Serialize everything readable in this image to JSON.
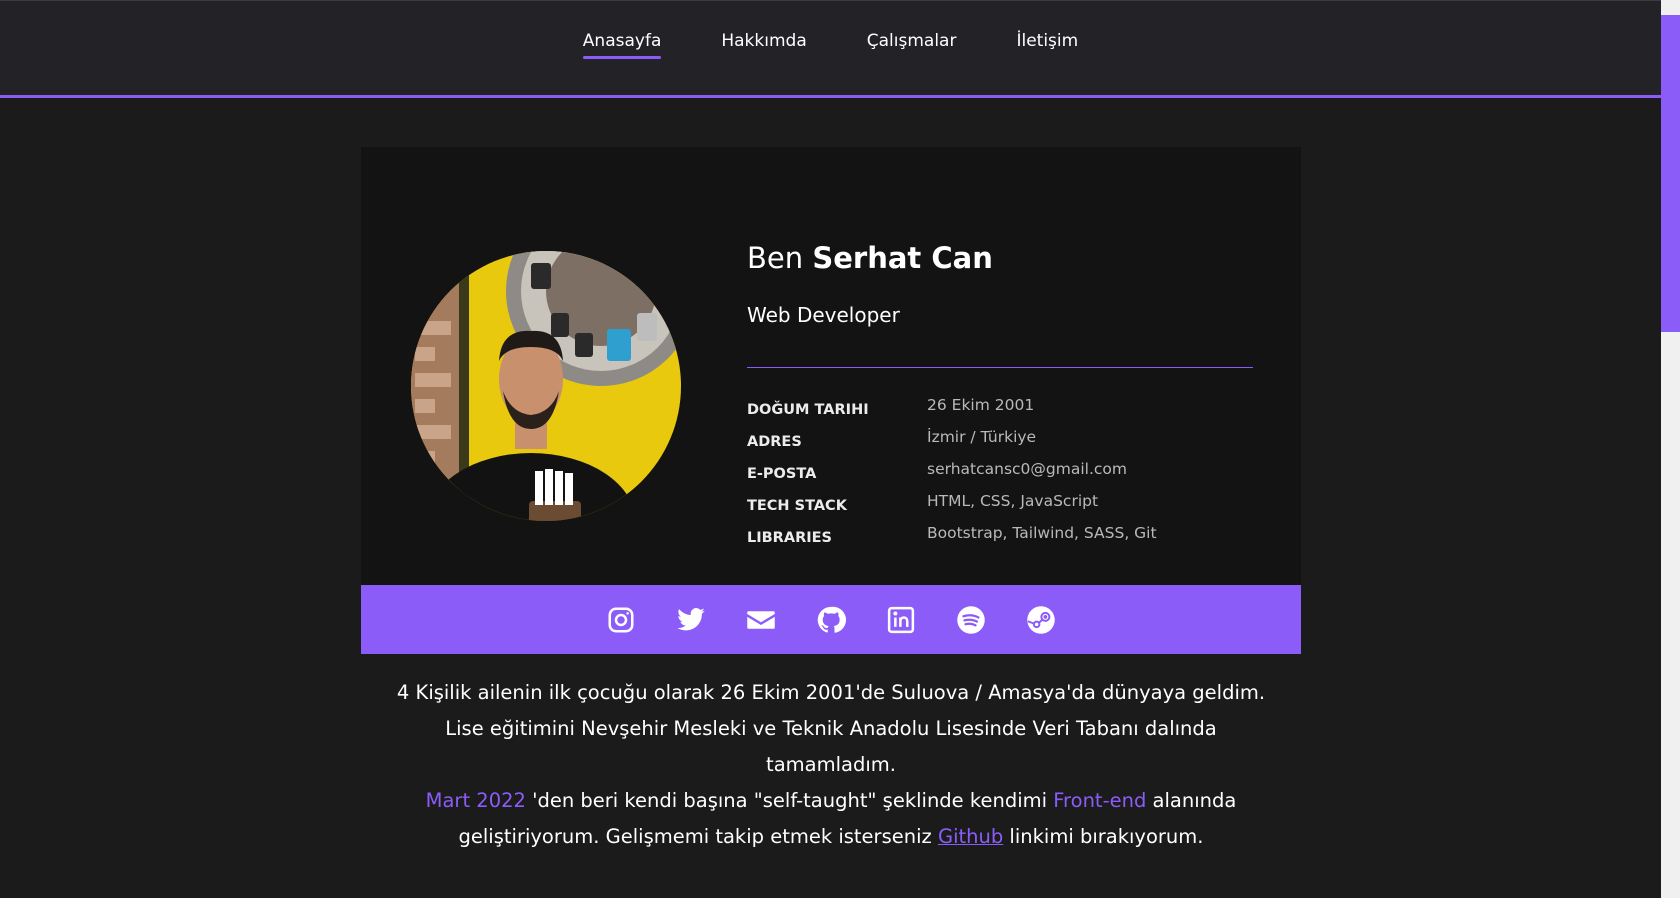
{
  "nav": {
    "items": [
      {
        "label": "Anasayfa",
        "active": true
      },
      {
        "label": "Hakkımda",
        "active": false
      },
      {
        "label": "Çalışmalar",
        "active": false
      },
      {
        "label": "İletişim",
        "active": false
      }
    ]
  },
  "colors": {
    "accent": "#8c5cf8",
    "background": "#1b1b1c",
    "card": "#131314",
    "navbar": "#232327"
  },
  "profile": {
    "intro": "Ben",
    "name": "Serhat Can",
    "role": "Web Developer",
    "avatar_icon": "profile-photo",
    "details": [
      {
        "key": "DOĞUM TARIHI",
        "value": "26 Ekim 2001"
      },
      {
        "key": "ADRES",
        "value": "İzmir / Türkiye"
      },
      {
        "key": "E-POSTA",
        "value": "serhatcansc0@gmail.com"
      },
      {
        "key": "TECH STACK",
        "value": "HTML, CSS, JavaScript"
      },
      {
        "key": "LIBRARIES",
        "value": "Bootstrap, Tailwind, SASS, Git"
      }
    ]
  },
  "social": {
    "icons": [
      "instagram-icon",
      "twitter-icon",
      "mail-icon",
      "github-icon",
      "linkedin-icon",
      "spotify-icon",
      "steam-icon"
    ]
  },
  "bio": {
    "p1": "4 Kişilik ailenin ilk çocuğu olarak 26 Ekim 2001'de Suluova / Amasya'da dünyaya geldim. Lise eğitimini Nevşehir Mesleki ve Teknik Anadolu Lisesinde Veri Tabanı dalında tamamladım.",
    "highlight1": "Mart 2022",
    "p2": " 'den beri kendi başına \"self-taught\" şeklinde kendimi ",
    "highlight2": "Front-end",
    "p3": " alanında geliştiriyorum. Gelişmemi takip etmek isterseniz ",
    "link": "Github",
    "p4": " linkimi bırakıyorum."
  }
}
